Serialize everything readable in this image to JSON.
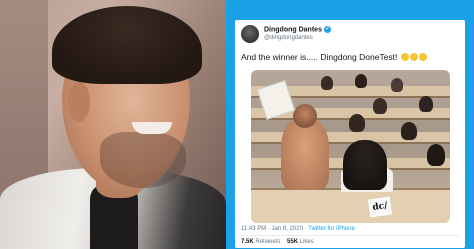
{
  "tweet": {
    "display_name": "Dingdong Dantes",
    "handle": "@dingdongdantes",
    "text": "And the winner is..... Dingdong DoneTest!",
    "emoji_count": 3,
    "photo_sheet_text": "dc/",
    "timestamp": "11:43 PM · Jan 8, 2020 ·",
    "source": "Twitter for iPhone",
    "retweets": "7.5K",
    "retweets_label": "Retweets",
    "likes": "55K",
    "likes_label": "Likes"
  },
  "colors": {
    "background_blue": "#1aa1e6",
    "verified_blue": "#1da1f2",
    "emoji_yellow": "#f7c532"
  }
}
